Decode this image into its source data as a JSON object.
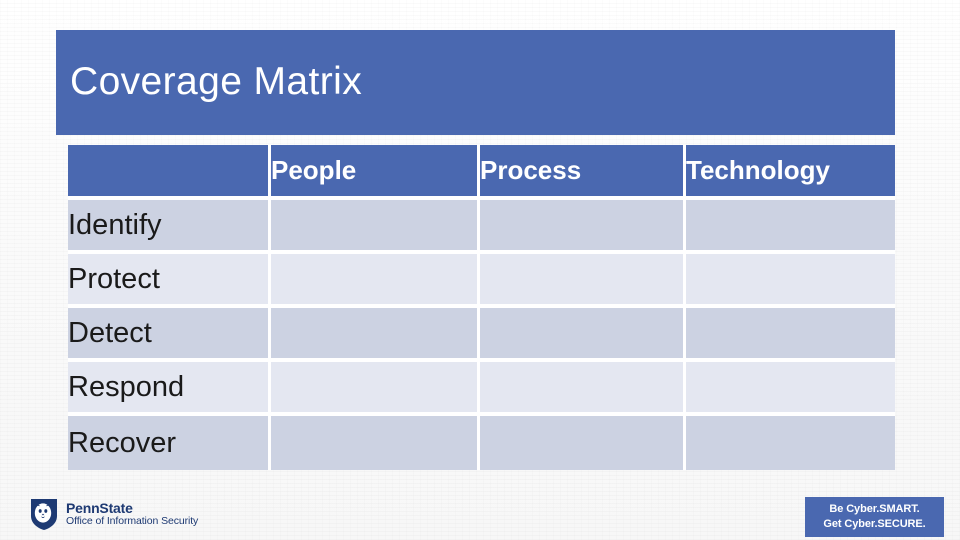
{
  "slide": {
    "title": "Coverage Matrix",
    "accent_color": "#4a68b0",
    "band_dark_color": "#ccd2e2",
    "band_light_color": "#e4e7f1"
  },
  "matrix": {
    "corner_header": "",
    "column_headers": [
      "People",
      "Process",
      "Technology"
    ],
    "rows": [
      {
        "label": "Identify",
        "cells": [
          "",
          "",
          ""
        ]
      },
      {
        "label": "Protect",
        "cells": [
          "",
          "",
          ""
        ]
      },
      {
        "label": "Detect",
        "cells": [
          "",
          "",
          ""
        ]
      },
      {
        "label": "Respond",
        "cells": [
          "",
          "",
          ""
        ]
      },
      {
        "label": "Recover",
        "cells": [
          "",
          "",
          ""
        ]
      }
    ]
  },
  "footer": {
    "logo": {
      "icon": "penn-state-shield-lion-icon",
      "name": "PennState",
      "unit": "Office of Information Security",
      "color": "#1e3a73"
    },
    "badge": {
      "line1": "Be Cyber.SMART.",
      "line2": "Get Cyber.SECURE.",
      "background_color": "#4a68b0"
    }
  }
}
